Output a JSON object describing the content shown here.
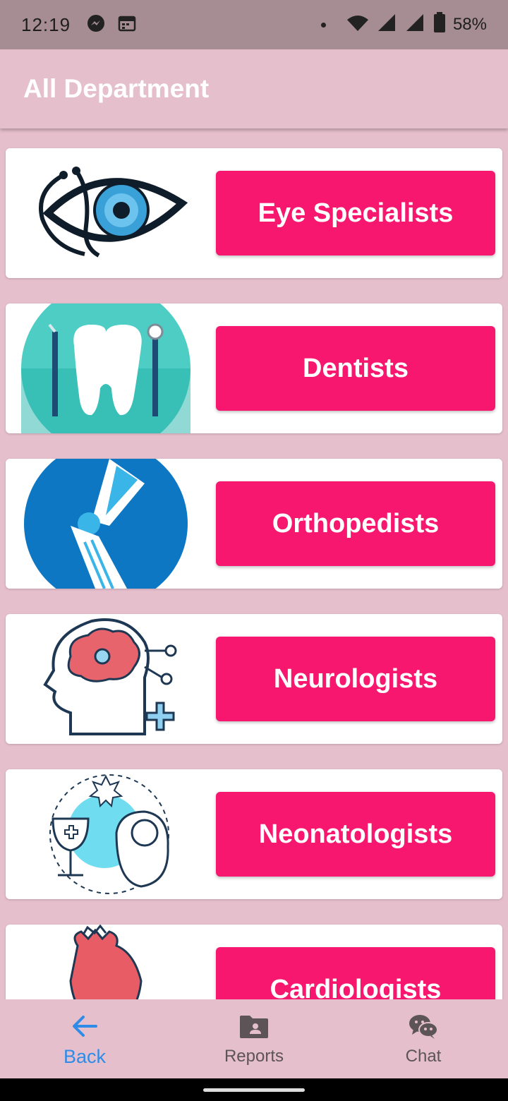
{
  "status": {
    "time": "12:19",
    "battery": "58%",
    "icons": [
      "messenger-icon",
      "calendar-icon",
      "wifi-icon",
      "signal-icon",
      "battery-icon"
    ]
  },
  "header": {
    "title": "All Department"
  },
  "departments": [
    {
      "label": "Eye Specialists",
      "icon": "eye-stethoscope-icon"
    },
    {
      "label": "Dentists",
      "icon": "tooth-icon"
    },
    {
      "label": "Orthopedists",
      "icon": "knee-joint-icon"
    },
    {
      "label": "Neurologists",
      "icon": "brain-head-icon"
    },
    {
      "label": "Neonatologists",
      "icon": "newborn-icon"
    },
    {
      "label": "Cardiologists",
      "icon": "heart-icon"
    }
  ],
  "bottom_nav": [
    {
      "label": "Back",
      "icon": "arrow-left-icon",
      "active": true
    },
    {
      "label": "Reports",
      "icon": "folder-user-icon",
      "active": false
    },
    {
      "label": "Chat",
      "icon": "chat-bubbles-icon",
      "active": false
    }
  ],
  "colors": {
    "background": "#e6bfcc",
    "accent_button": "#f7176f",
    "status_bar": "#a68d94",
    "active_nav": "#2e8ce8"
  }
}
